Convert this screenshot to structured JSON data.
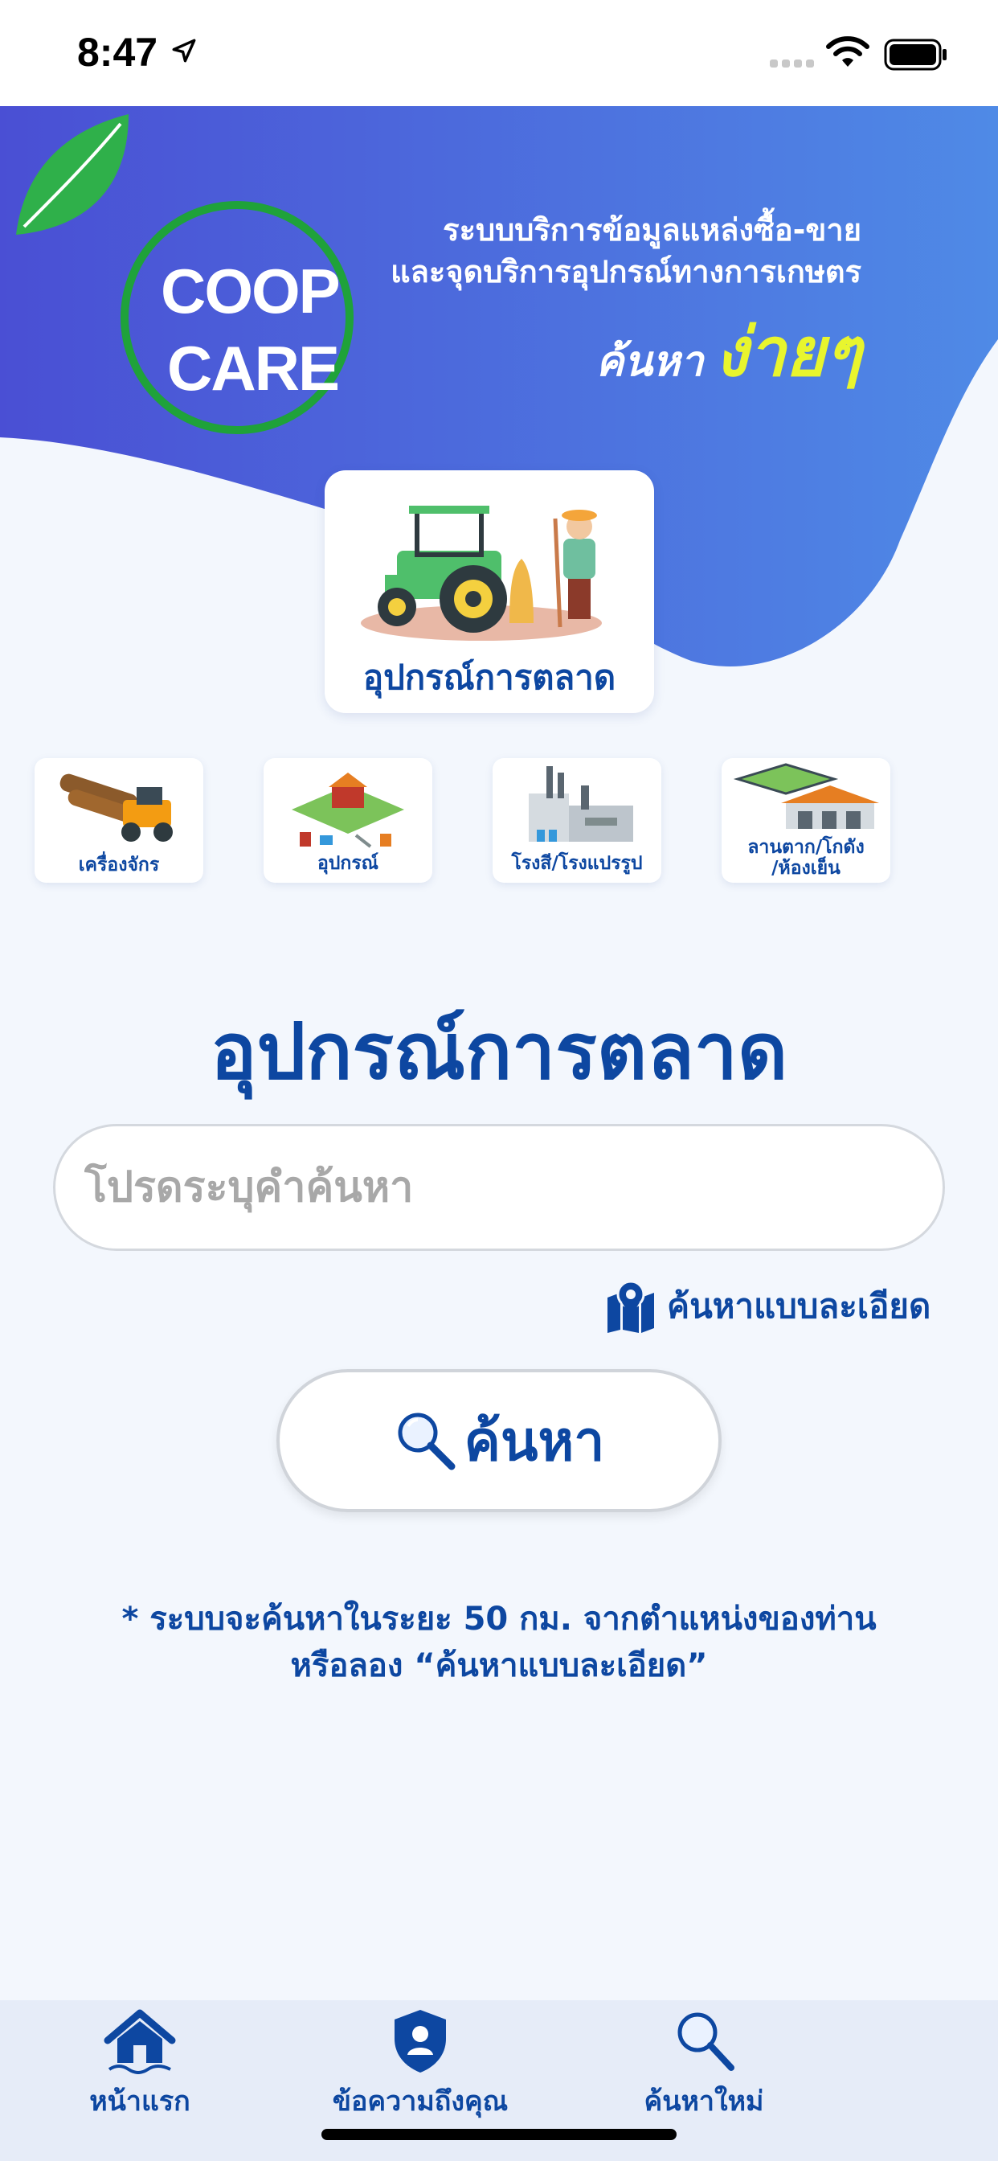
{
  "status_bar": {
    "time": "8:47"
  },
  "banner": {
    "logo_line1": "COOP",
    "logo_line2": "CARE",
    "tagline_line1": "ระบบบริการข้อมูลแหล่งซื้อ-ขาย",
    "tagline_line2": "และจุดบริการอุปกรณ์ทางการเกษตร",
    "search_word": "ค้นหา",
    "easy_word": "ง่ายๆ"
  },
  "selected_category": {
    "label": "อุปกรณ์การตลาด"
  },
  "categories": [
    {
      "label": "เครื่องจักร"
    },
    {
      "label": "อุปกรณ์"
    },
    {
      "label": "โรงสี/โรงแปรรูป"
    },
    {
      "label_line1": "ลานตาก/โกดัง",
      "label_line2": "/ห้องเย็น"
    }
  ],
  "page_title": "อุปกรณ์การตลาด",
  "search": {
    "placeholder": "โปรดระบุคำค้นหา",
    "value": "",
    "advanced_label": "ค้นหาแบบละเอียด",
    "button_label": "ค้นหา"
  },
  "note": {
    "line1": "* ระบบจะค้นหาในระยะ 50 กม. จากตำแหน่งของท่าน",
    "line2": "หรือลอง “ค้นหาแบบละเอียด”"
  },
  "tabbar": {
    "home": "หน้าแรก",
    "messages": "ข้อความถึงคุณ",
    "new_search": "ค้นหาใหม่"
  },
  "colors": {
    "primary": "#0d47a1",
    "banner_start": "#4a55d6",
    "banner_end": "#4f8ae6",
    "accent_yellow": "#e8f52e",
    "logo_green": "#1fa23a",
    "background": "#f3f7fd"
  },
  "icons": [
    "location-arrow-icon",
    "signal-icon",
    "wifi-icon",
    "battery-icon",
    "map-pin-icon",
    "search-icon",
    "home-icon",
    "shield-user-icon"
  ]
}
